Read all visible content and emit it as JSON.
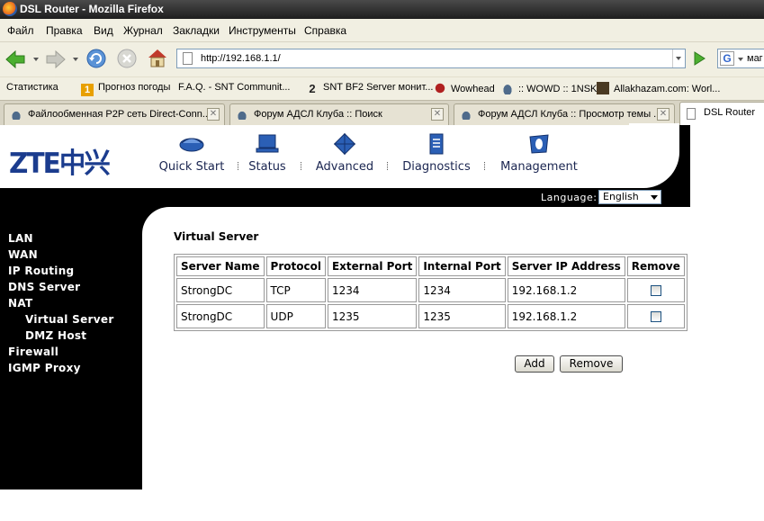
{
  "window": {
    "title": "DSL Router - Mozilla Firefox"
  },
  "menu": [
    "Файл",
    "Правка",
    "Вид",
    "Журнал",
    "Закладки",
    "Инструменты",
    "Справка"
  ],
  "url": "http://192.168.1.1/",
  "search_text": "маг",
  "bookmarks": [
    "Статистика",
    "Прогноз погоды",
    "F.A.Q. - SNT Communit...",
    "SNT BF2 Server монит...",
    "Wowhead",
    ":: WOWD :: 1NSK",
    "Allakhazam.com: Worl..."
  ],
  "bookmark_icons": {
    "b1": "1",
    "b3": "2"
  },
  "tabs": [
    {
      "label": "Файлообменная P2P сеть Direct-Conn..."
    },
    {
      "label": "Форум АДСЛ Клуба :: Поиск"
    },
    {
      "label": "Форум АДСЛ Клуба :: Просмотр темы ..."
    },
    {
      "label": "DSL Router"
    }
  ],
  "router": {
    "logo": "ZTE中兴",
    "nav": [
      "Quick Start",
      "Status",
      "Advanced",
      "Diagnostics",
      "Management"
    ],
    "language_label": "Language:",
    "language_value": "English",
    "sidebar": [
      "LAN",
      "WAN",
      "IP Routing",
      "DNS Server",
      "NAT",
      "Virtual Server",
      "DMZ Host",
      "Firewall",
      "IGMP Proxy"
    ],
    "page_title": "Virtual Server",
    "table": {
      "headers": [
        "Server Name",
        "Protocol",
        "External Port",
        "Internal Port",
        "Server IP Address",
        "Remove"
      ],
      "rows": [
        [
          "StrongDC",
          "TCP",
          "1234",
          "1234",
          "192.168.1.2"
        ],
        [
          "StrongDC",
          "UDP",
          "1235",
          "1235",
          "192.168.1.2"
        ]
      ]
    },
    "buttons": {
      "add": "Add",
      "remove": "Remove"
    }
  },
  "colors": {
    "brand_blue": "#1b3c8e",
    "sidebar_bg": "#000000",
    "chrome_bg": "#f1efe2"
  }
}
